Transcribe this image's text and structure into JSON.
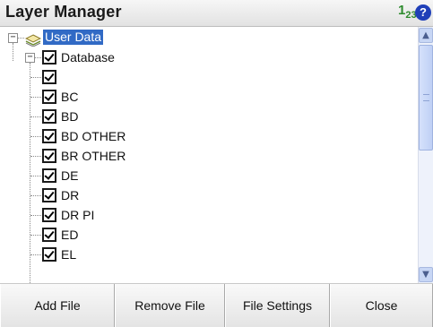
{
  "header": {
    "title": "Layer Manager",
    "units_icon": "units-123-icon",
    "help_icon": "help-icon",
    "help_glyph": "?"
  },
  "tree": {
    "root": {
      "label": "User Data",
      "expanded": true,
      "selected": true,
      "icon": "layers-icon"
    },
    "group": {
      "label": "Database",
      "expanded": true,
      "checked": true
    },
    "layers": [
      {
        "label": "",
        "checked": true
      },
      {
        "label": "BC",
        "checked": true
      },
      {
        "label": "BD",
        "checked": true
      },
      {
        "label": "BD OTHER",
        "checked": true
      },
      {
        "label": "BR OTHER",
        "checked": true
      },
      {
        "label": "DE",
        "checked": true
      },
      {
        "label": "DR",
        "checked": true
      },
      {
        "label": "DR PI",
        "checked": true
      },
      {
        "label": "ED",
        "checked": true
      },
      {
        "label": "EL",
        "checked": true
      }
    ]
  },
  "toolbar": {
    "add_file": "Add File",
    "remove_file": "Remove File",
    "file_settings": "File Settings",
    "close": "Close"
  },
  "colors": {
    "selection": "#316ac5",
    "scrollbar": "#c7d6f5",
    "help_icon": "#1f3fb8",
    "units_icon": "#2e8b2e"
  }
}
